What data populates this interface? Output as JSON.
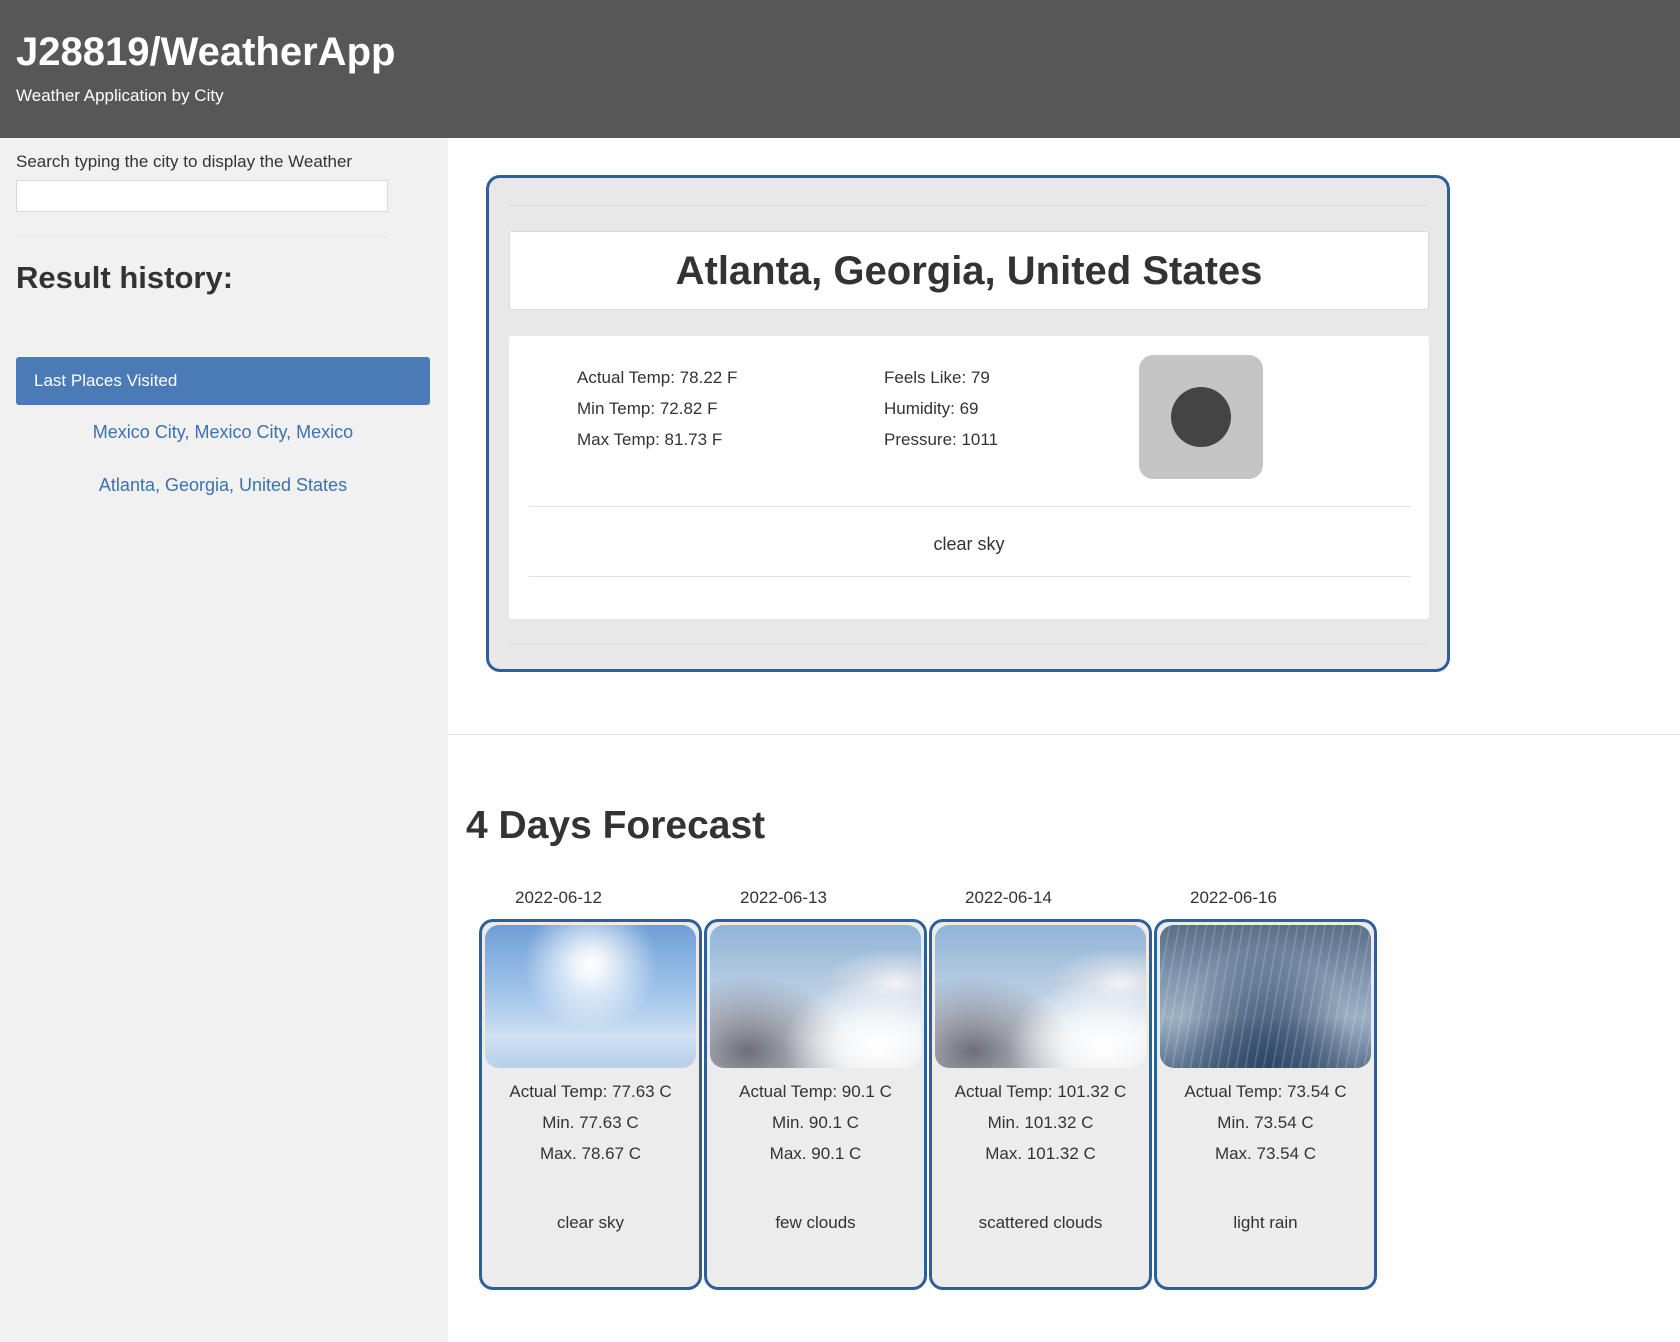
{
  "header": {
    "title": "J28819/WeatherApp",
    "subtitle": "Weather Application by City"
  },
  "sidebar": {
    "search_label": "Search typing the city to display the Weather",
    "search_value": "",
    "history_title": "Result history:",
    "places_header": "Last Places Visited",
    "places": [
      "Mexico City, Mexico City, Mexico",
      "Atlanta, Georgia, United States"
    ]
  },
  "current": {
    "city": "Atlanta, Georgia, United States",
    "actual_temp": "Actual Temp: 78.22 F",
    "min_temp": "Min Temp: 72.82 F",
    "max_temp": "Max Temp: 81.73 F",
    "feels_like": "Feels Like: 79",
    "humidity": "Humidity: 69",
    "pressure": "Pressure: 1011",
    "icon": "clear-sky-icon",
    "description": "clear sky"
  },
  "forecast": {
    "title": "4 Days Forecast",
    "days": [
      {
        "date": "2022-06-12",
        "image": "clear-sky-image",
        "actual": "Actual Temp: 77.63 C",
        "min": "Min. 77.63 C",
        "max": "Max. 78.67 C",
        "description": "clear sky"
      },
      {
        "date": "2022-06-13",
        "image": "few-clouds-image",
        "actual": "Actual Temp: 90.1 C",
        "min": "Min. 90.1 C",
        "max": "Max. 90.1 C",
        "description": "few clouds"
      },
      {
        "date": "2022-06-14",
        "image": "scattered-clouds-image",
        "actual": "Actual Temp: 101.32 C",
        "min": "Min. 101.32 C",
        "max": "Max. 101.32 C",
        "description": "scattered clouds"
      },
      {
        "date": "2022-06-16",
        "image": "light-rain-image",
        "actual": "Actual Temp: 73.54 C",
        "min": "Min. 73.54 C",
        "max": "Max. 73.54 C",
        "description": "light rain"
      }
    ]
  },
  "colors": {
    "header_bg": "#575757",
    "sidebar_bg": "#f1f1f1",
    "accent": "#4a7bb7",
    "card_border": "#2e5f98",
    "link": "#3b71b0"
  }
}
